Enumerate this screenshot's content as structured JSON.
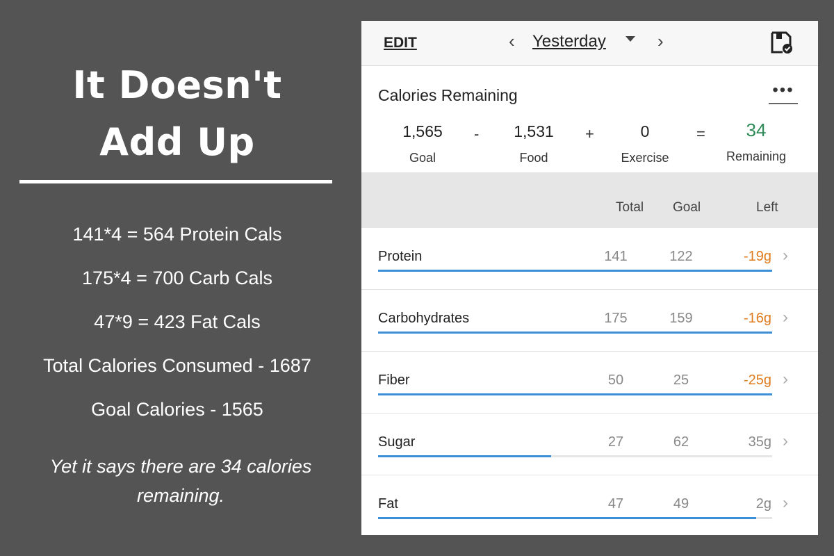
{
  "left_panel": {
    "headline_line1": "It Doesn't",
    "headline_line2": "Add Up",
    "calculations": [
      "141*4 = 564 Protein Cals",
      "175*4 = 700 Carb Cals",
      "47*9 = 423 Fat Cals",
      "Total Calories Consumed - 1687",
      "Goal Calories - 1565"
    ],
    "note": "Yet it says there are 34 calories remaining."
  },
  "app": {
    "topbar": {
      "edit_label": "EDIT",
      "prev_icon": "chevron-left-icon",
      "next_icon": "chevron-right-icon",
      "day_label": "Yesterday",
      "save_icon": "save-check-icon"
    },
    "calories": {
      "title": "Calories Remaining",
      "more_icon": "more-dots-icon",
      "goal": {
        "value": "1,565",
        "label": "Goal"
      },
      "food": {
        "value": "1,531",
        "label": "Food"
      },
      "exercise": {
        "value": "0",
        "label": "Exercise"
      },
      "remaining": {
        "value": "34",
        "label": "Remaining"
      },
      "op_minus": "-",
      "op_plus": "+",
      "op_equals": "="
    },
    "table": {
      "headers": {
        "total": "Total",
        "goal": "Goal",
        "left": "Left"
      },
      "rows": [
        {
          "label": "Protein",
          "total": "141",
          "goal": "122",
          "left": "-19g",
          "over": true,
          "progress": 1.0
        },
        {
          "label": "Carbohydrates",
          "total": "175",
          "goal": "159",
          "left": "-16g",
          "over": true,
          "progress": 1.0
        },
        {
          "label": "Fiber",
          "total": "50",
          "goal": "25",
          "left": "-25g",
          "over": true,
          "progress": 1.0
        },
        {
          "label": "Sugar",
          "total": "27",
          "goal": "62",
          "left": "35g",
          "over": false,
          "progress": 0.44
        },
        {
          "label": "Fat",
          "total": "47",
          "goal": "49",
          "left": "2g",
          "over": false,
          "progress": 0.96
        }
      ]
    },
    "colors": {
      "accent_bar": "#3a8fd8",
      "over_text": "#e07b1c",
      "remaining_green": "#2e8b57"
    }
  }
}
